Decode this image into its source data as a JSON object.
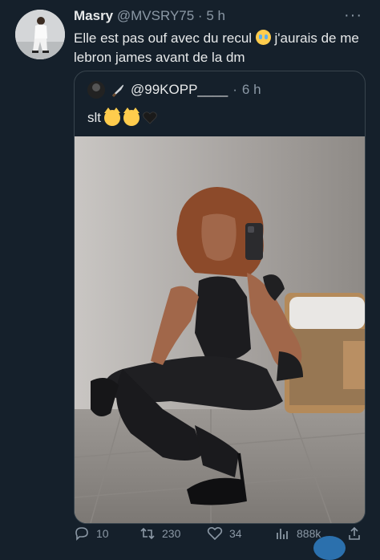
{
  "tweet": {
    "author_name": "Masry",
    "author_handle": "@MVSRY75",
    "separator": " · ",
    "time": "5 h",
    "more_label": "···",
    "text_part1": "Elle est pas ouf avec du recul ",
    "text_part2": " j'aurais de me lebron james avant de la dm",
    "emoji_icon": "loudly-crying-face-icon"
  },
  "quote": {
    "handle": "@99KOPP____",
    "separator": " · ",
    "time": "6 h",
    "text": "slt",
    "emojis": [
      "kissing-cat-icon",
      "kissing-cat-icon",
      "black-heart-icon"
    ],
    "badge_icon": "knife-icon"
  },
  "actions": {
    "replies": "10",
    "retweets": "230",
    "likes": "34",
    "views": "888k"
  },
  "colors": {
    "background": "#15202b",
    "text": "#e7e9ea",
    "muted": "#8b98a5",
    "border": "#38444d"
  }
}
